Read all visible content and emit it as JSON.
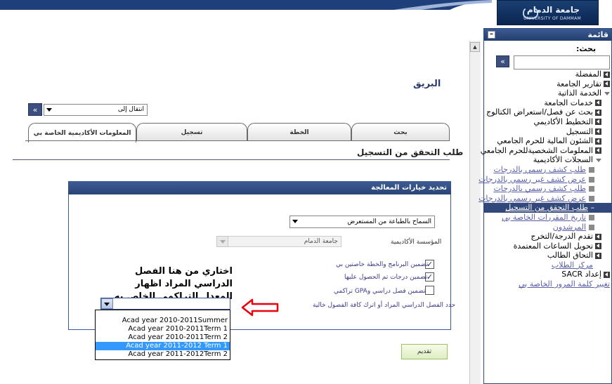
{
  "logo": {
    "arabic": "جامعة الدمام",
    "english": "UNIVERSITY OF DAMMAM"
  },
  "sidebar": {
    "title": "قائمة",
    "search_label": "بحث:",
    "items": [
      {
        "label": "المفضلة",
        "type": "tri",
        "level": 0
      },
      {
        "label": "تقارير الجامعة",
        "type": "tri",
        "level": 0
      },
      {
        "label": "الخدمة الذاتية",
        "type": "open",
        "level": 0
      },
      {
        "label": "خدمات الجامعة",
        "type": "tri",
        "level": 1
      },
      {
        "label": "بحث عن فصل/استعراض الكتالوج",
        "type": "tri",
        "level": 1
      },
      {
        "label": "التخطيط الأكاديمي",
        "type": "tri",
        "level": 1
      },
      {
        "label": "التسجيل",
        "type": "tri",
        "level": 1
      },
      {
        "label": "الشئون المالية للحرم الجامعي",
        "type": "tri",
        "level": 1
      },
      {
        "label": "المعلومات الشخصيةللحرم الجامعي",
        "type": "tri",
        "level": 1
      },
      {
        "label": "السجلات الأكاديمية",
        "type": "open",
        "level": 1
      },
      {
        "label": "طلب كشف رسمي بالدرجات",
        "type": "sq",
        "level": 2
      },
      {
        "label": "عرض كشف غير رسمي بالدرجات",
        "type": "sq",
        "level": 2
      },
      {
        "label": "طلب كشف رسمي بالدرجات",
        "type": "sq",
        "level": 2
      },
      {
        "label": "عرض كشف غير رسمي بالدرجات",
        "type": "sq",
        "level": 2
      },
      {
        "label": "طلب التحقق من التسجيل",
        "type": "active",
        "level": 2
      },
      {
        "label": "تاريخ المقررات الخاصة بي",
        "type": "sq",
        "level": 2
      },
      {
        "label": "المرشدون",
        "type": "sq",
        "level": 2
      },
      {
        "label": "تقدم الدرجة/التخرج",
        "type": "tri",
        "level": 1
      },
      {
        "label": "تحويل الساعات المعتمدة",
        "type": "tri",
        "level": 1
      },
      {
        "label": "التحاق الطالب",
        "type": "tri",
        "level": 1
      },
      {
        "label": "مركز الطلاب",
        "type": "link",
        "level": 1
      },
      {
        "label": "إعداد SACR",
        "type": "tri",
        "level": 0
      },
      {
        "label": "تغيير كلمة المرور الخاصة بي",
        "type": "link",
        "level": 0
      }
    ]
  },
  "main": {
    "title": "البريق",
    "goto_label": "انتقال إلى",
    "tabs": [
      "بحث",
      "الخطة",
      "تسجيل",
      "المعلومات الأكاديمية الخاصة بي"
    ],
    "page_subtitle": "طلب التحقق من التسجيل",
    "box_title": "تحديد خيارات المعالجة",
    "print_option": "السماح بالطباعة من المستعرض",
    "institution_label": "المؤسسة الأكاديمية",
    "institution_value": "جامعة الدمام",
    "checkboxes": [
      {
        "label": "تضمين البرنامج والخطة خاصتين بي",
        "checked": true
      },
      {
        "label": "تضمين درجات تم الحصول عليها",
        "checked": true
      },
      {
        "label": "تضمين فصل دراسي وGPA تراكمي",
        "checked": false
      }
    ],
    "note": "اختاري من هنا الفصل الدراسي المراد اظهار المعدل التراكمي الخاص به",
    "term_label": "حدد الفصل الدراسي المراد أو اترك كافة الفصول خالية",
    "term_options": [
      "Acad year 2010-2011Summer",
      "Acad year 2010-2011Term 1",
      "Acad year 2010-2011Term 2",
      "Acad year 2011-2012 Term 1",
      "Acad year 2011-2012Term 2"
    ],
    "selected_term_index": 3,
    "submit_label": "تقديم"
  },
  "colors": {
    "header_blue": "#2a4475",
    "active_nav": "#32477a",
    "highlight": "#3399ff",
    "annotation_red": "#e8000a"
  }
}
